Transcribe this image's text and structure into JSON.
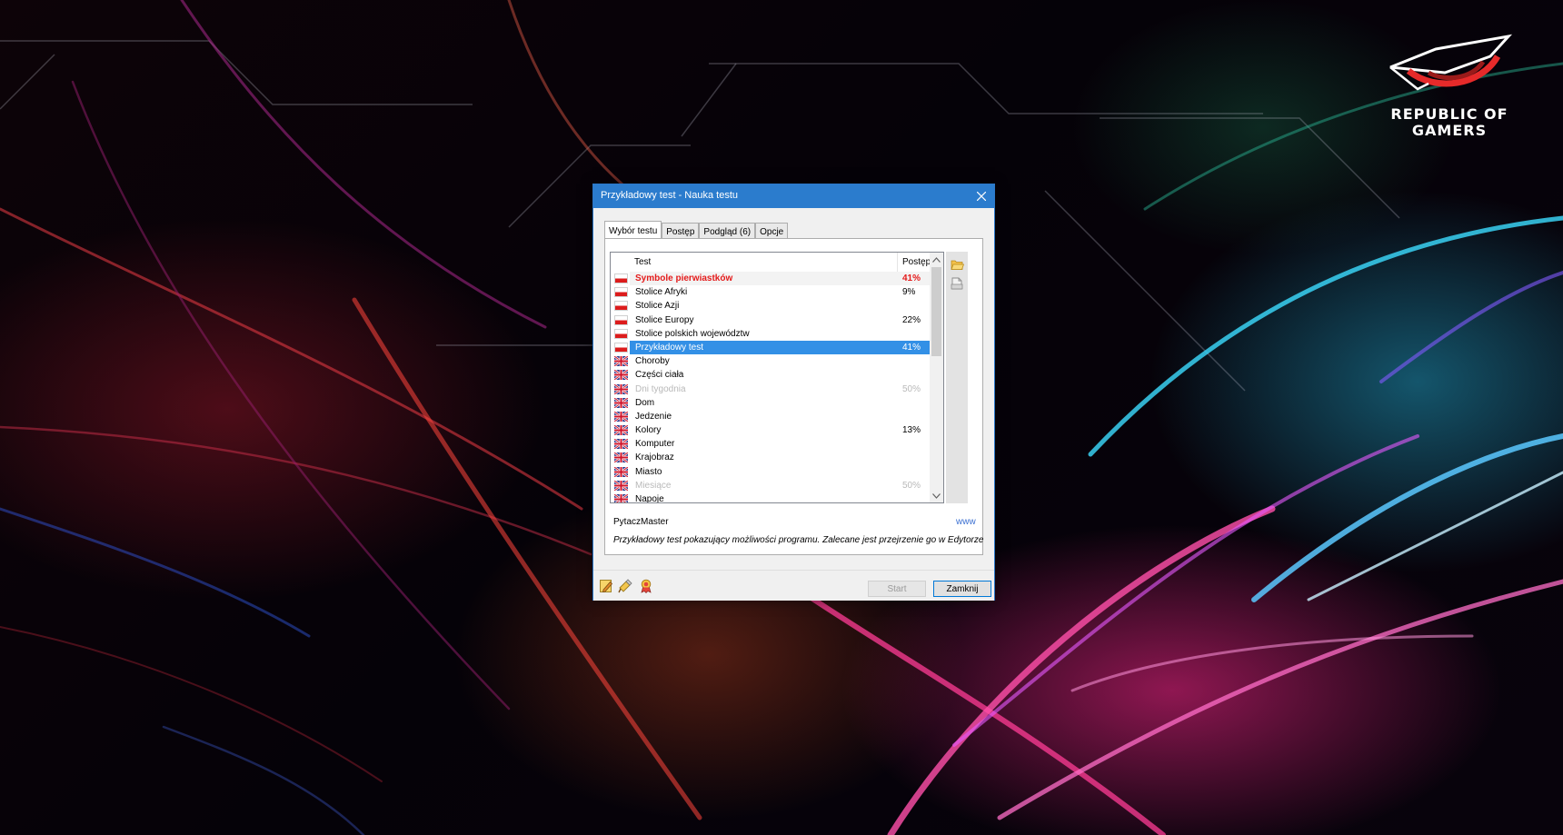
{
  "desktop": {
    "logo": {
      "line1": "REPUBLIC OF",
      "line2": "GAMERS"
    }
  },
  "window": {
    "title": "Przykładowy test - Nauka testu",
    "tabs": [
      {
        "label": "Wybór testu",
        "active": true
      },
      {
        "label": "Postęp",
        "active": false
      },
      {
        "label": "Podgląd (6)",
        "active": false
      },
      {
        "label": "Opcje",
        "active": false
      }
    ],
    "list": {
      "columns": {
        "test": "Test",
        "progress": "Postęp"
      },
      "rows": [
        {
          "flag": "pl-flag",
          "name": "Symbole pierwiastków",
          "progress": "41%",
          "state": "hot"
        },
        {
          "flag": "pl-flag",
          "name": "Stolice Afryki",
          "progress": "9%",
          "state": "normal"
        },
        {
          "flag": "pl-flag",
          "name": "Stolice Azji",
          "progress": "",
          "state": "normal"
        },
        {
          "flag": "pl-flag",
          "name": "Stolice Europy",
          "progress": "22%",
          "state": "normal"
        },
        {
          "flag": "pl-flag",
          "name": "Stolice polskich województw",
          "progress": "",
          "state": "normal"
        },
        {
          "flag": "pl-flag",
          "name": "Przykładowy test",
          "progress": "41%",
          "state": "selected"
        },
        {
          "flag": "uk-flag",
          "name": "Choroby",
          "progress": "",
          "state": "normal"
        },
        {
          "flag": "uk-flag",
          "name": "Części ciała",
          "progress": "",
          "state": "normal"
        },
        {
          "flag": "uk-flag",
          "name": "Dni tygodnia",
          "progress": "50%",
          "state": "dim"
        },
        {
          "flag": "uk-flag",
          "name": "Dom",
          "progress": "",
          "state": "normal"
        },
        {
          "flag": "uk-flag",
          "name": "Jedzenie",
          "progress": "",
          "state": "normal"
        },
        {
          "flag": "uk-flag",
          "name": "Kolory",
          "progress": "13%",
          "state": "normal"
        },
        {
          "flag": "uk-flag",
          "name": "Komputer",
          "progress": "",
          "state": "normal"
        },
        {
          "flag": "uk-flag",
          "name": "Krajobraz",
          "progress": "",
          "state": "normal"
        },
        {
          "flag": "uk-flag",
          "name": "Miasto",
          "progress": "",
          "state": "normal"
        },
        {
          "flag": "uk-flag",
          "name": "Miesiące",
          "progress": "50%",
          "state": "dim"
        },
        {
          "flag": "uk-flag",
          "name": "Napoje",
          "progress": "",
          "state": "normal"
        }
      ]
    },
    "side_tools": [
      "folder-open-icon",
      "document-icon"
    ],
    "info": {
      "app_name": "PytaczMaster",
      "link": "www",
      "description": "Przykładowy test pokazujący możliwości programu. Zalecane jest przejrzenie go w Edytorze"
    },
    "bottom_tools": [
      "edit-icon",
      "tools-icon",
      "award-icon"
    ],
    "buttons": {
      "start": "Start",
      "close": "Zamknij"
    }
  },
  "colors": {
    "titlebar": "#2b7ccd",
    "selection": "#3390e6",
    "highlight_text": "#e41b1b",
    "dim_text": "#b9b9b9"
  }
}
